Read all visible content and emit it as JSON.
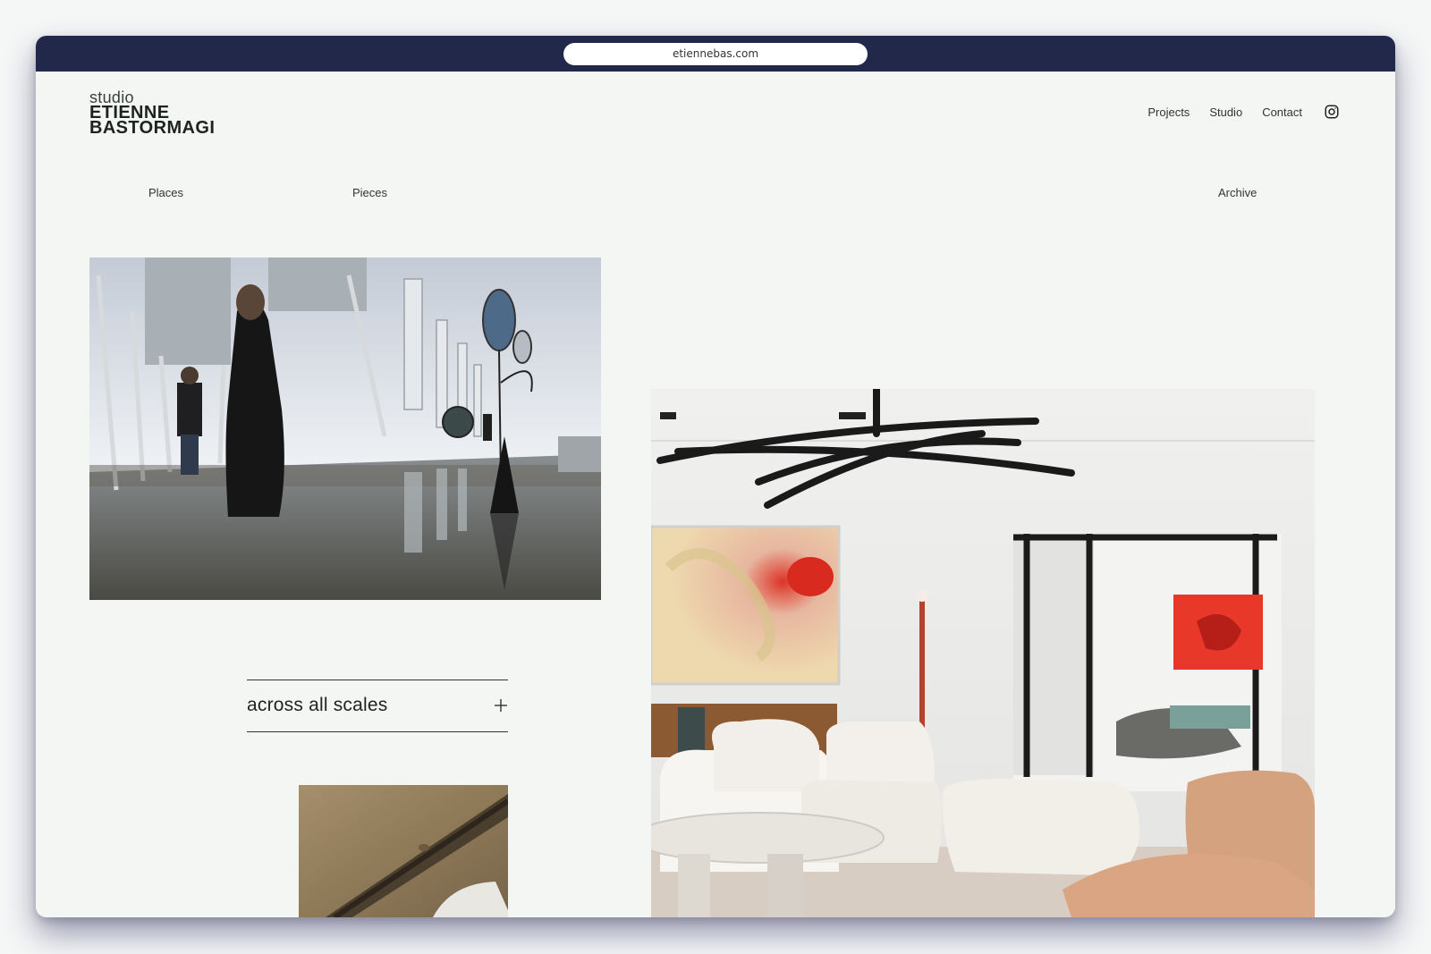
{
  "browser": {
    "url": "etiennebas.com"
  },
  "logo": {
    "line1": "studio",
    "line2": "ETIENNE",
    "line3": "BASTORMAGI"
  },
  "topnav": {
    "projects": "Projects",
    "studio": "Studio",
    "contact": "Contact",
    "instagram_icon": "instagram-icon"
  },
  "subnav": {
    "places": "Places",
    "pieces": "Pieces",
    "archive": "Archive"
  },
  "accordion": {
    "label": "across all scales",
    "icon": "plus-icon"
  },
  "images": [
    {
      "name": "rooftop-installation-photo",
      "alt": "rooftop art installation"
    },
    {
      "name": "interior-living-room-photo",
      "alt": "living room interior"
    },
    {
      "name": "stone-detail-photo",
      "alt": "stone detail"
    }
  ]
}
